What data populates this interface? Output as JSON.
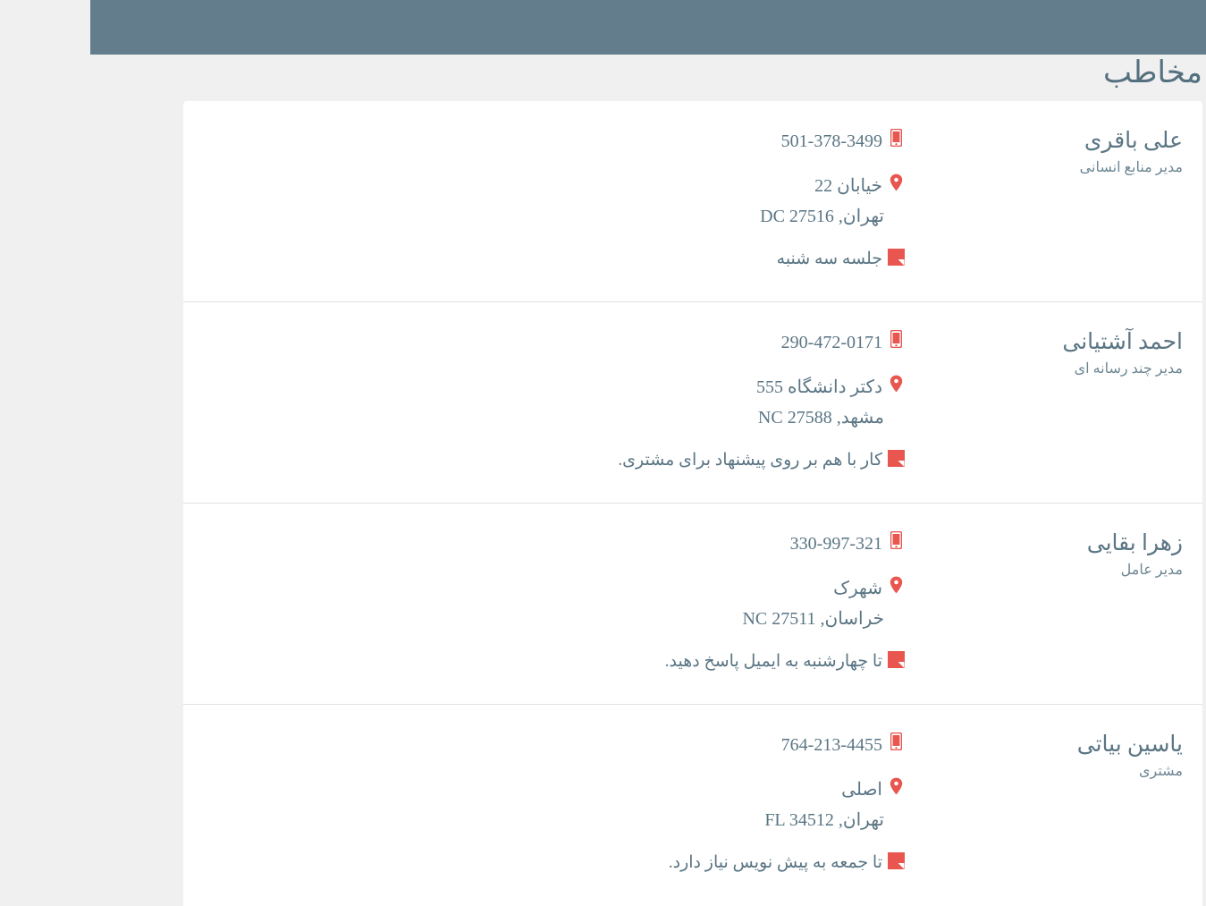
{
  "page": {
    "title": "مخاطب",
    "banner_color": "#637d8c",
    "accent_color": "#e8564f",
    "text_color": "#5a7584",
    "card_background": "#ffffff",
    "page_background": "#f0f0f0"
  },
  "icons": {
    "phone": "mobile-phone-icon",
    "address": "map-pin-icon",
    "note": "sticky-note-icon"
  },
  "contacts": [
    {
      "name": "علی باقری",
      "role": "مدیر منابع انسانی",
      "phone": "501-378-3499",
      "address_line1": "خیابان 22",
      "address_line2": "تهران, DC 27516",
      "note": "جلسه سه شنبه"
    },
    {
      "name": "احمد آشتیانی",
      "role": "مدیر چند رسانه ای",
      "phone": "290-472-0171",
      "address_line1": "دکتر دانشگاه 555",
      "address_line2": "مشهد, NC 27588",
      "note": "کار با هم بر روی پیشنهاد برای مشتری."
    },
    {
      "name": "زهرا بقایی",
      "role": "مدیر عامل",
      "phone": "330-997-321",
      "address_line1": "شهرک",
      "address_line2": "خراسان, NC 27511",
      "note": "تا چهارشنبه به ایمیل پاسخ دهید."
    },
    {
      "name": "یاسین بیاتی",
      "role": "مشتری",
      "phone": "764-213-4455",
      "address_line1": "اصلی",
      "address_line2": "تهران, FL 34512",
      "note": "تا جمعه به پیش نویس نیاز دارد."
    }
  ]
}
